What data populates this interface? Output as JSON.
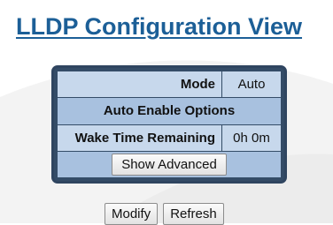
{
  "page": {
    "title": "LLDP Configuration View"
  },
  "config": {
    "mode_label": "Mode",
    "mode_value": "Auto",
    "auto_enable_header": "Auto Enable Options",
    "wake_label": "Wake Time Remaining",
    "wake_value": "0h 0m",
    "show_advanced_label": "Show Advanced"
  },
  "actions": {
    "modify_label": "Modify",
    "refresh_label": "Refresh"
  },
  "colors": {
    "title": "#1c5f97",
    "panel_border": "#344c67",
    "cell_light": "#c7d8ec",
    "cell_header": "#a8c1df"
  }
}
